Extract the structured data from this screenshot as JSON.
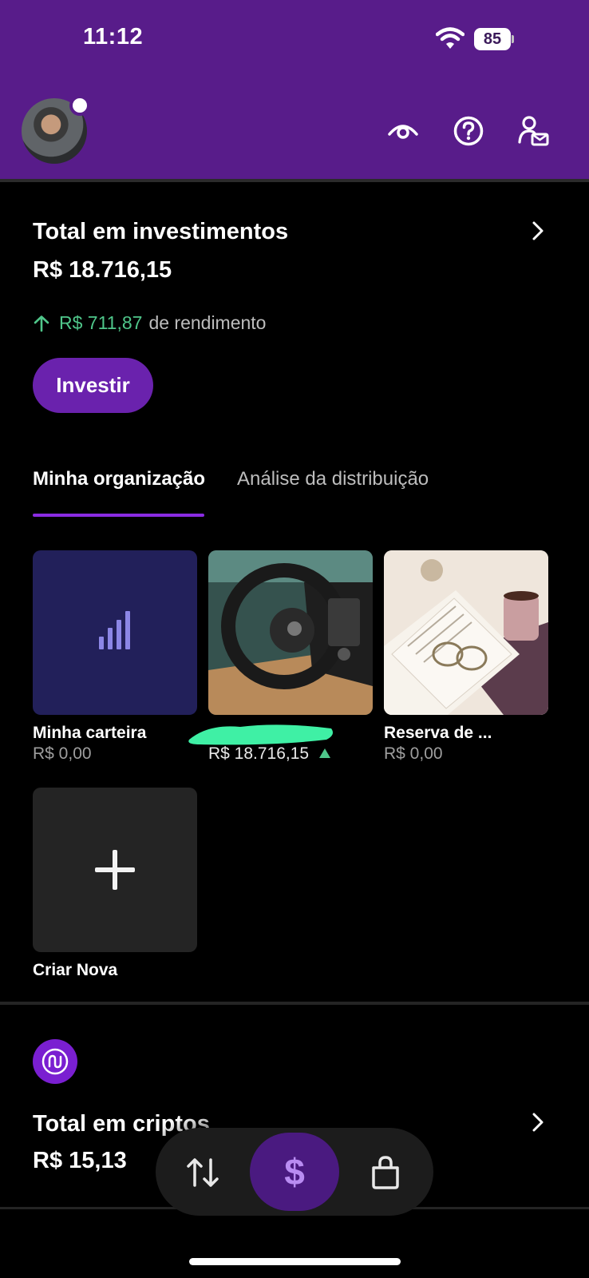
{
  "status_bar": {
    "time": "11:12",
    "battery": "85"
  },
  "header": {
    "avatar_alt": "Foto de perfil",
    "icons": [
      "eye-icon",
      "help-icon",
      "profile-message-icon"
    ]
  },
  "investments": {
    "title": "Total em investimentos",
    "amount": "R$ 18.716,15",
    "yield_value": "R$ 711,87",
    "yield_label": "de rendimento",
    "invest_button": "Investir"
  },
  "tabs": [
    {
      "label": "Minha organização",
      "active": true
    },
    {
      "label": "Análise da distribuição",
      "active": false
    }
  ],
  "cards": [
    {
      "label": "Minha carteira",
      "value": "R$ 0,00"
    },
    {
      "label": "",
      "value": "R$ 18.716,15"
    },
    {
      "label": "Reserva de ...",
      "value": "R$ 0,00"
    },
    {
      "label": "Criar Nova"
    }
  ],
  "crypto": {
    "title": "Total em criptos",
    "amount": "R$ 15,13"
  },
  "bottom_nav": {
    "money_symbol": "$",
    "items": [
      "transfer-icon",
      "money-icon",
      "shopping-bag-icon"
    ]
  },
  "colors": {
    "brand_purple": "#581c8a",
    "accent_purple": "#6a22ad",
    "yield_green": "#4fc68a",
    "redaction_green": "#3ff0a5"
  }
}
